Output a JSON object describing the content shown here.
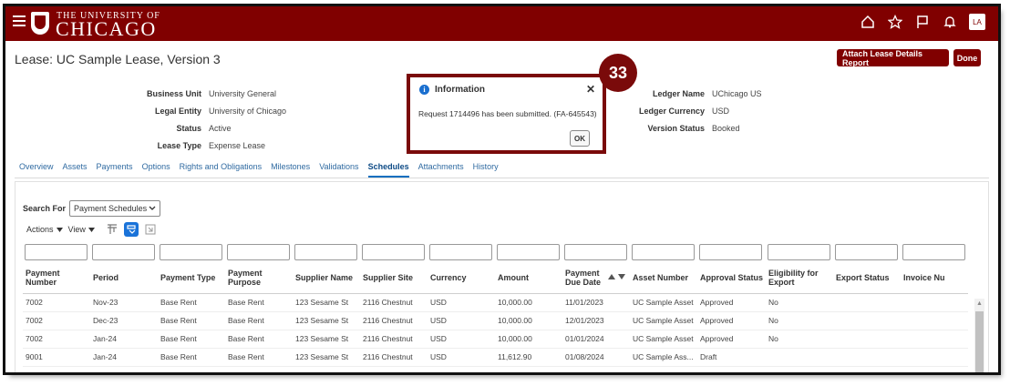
{
  "header": {
    "brand_small": "THE UNIVERSITY OF",
    "brand_big": "CHICAGO",
    "avatar": "LA"
  },
  "page": {
    "title": "Lease: UC Sample Lease, Version 3",
    "attach_button": "Attach Lease Details Report",
    "done_button": "Done"
  },
  "fields_left": [
    {
      "label": "Business Unit",
      "value": "University General"
    },
    {
      "label": "Legal Entity",
      "value": "University of Chicago"
    },
    {
      "label": "Status",
      "value": "Active"
    },
    {
      "label": "Lease Type",
      "value": "Expense Lease"
    }
  ],
  "fields_right": [
    {
      "label": "Ledger Name",
      "value": "UChicago US"
    },
    {
      "label": "Ledger Currency",
      "value": "USD"
    },
    {
      "label": "Version Status",
      "value": "Booked"
    }
  ],
  "tabs": [
    "Overview",
    "Assets",
    "Payments",
    "Options",
    "Rights and Obligations",
    "Milestones",
    "Validations",
    "Schedules",
    "Attachments",
    "History"
  ],
  "active_tab": "Schedules",
  "search": {
    "label": "Search For",
    "selected": "Payment Schedules"
  },
  "toolbar": {
    "actions": "Actions",
    "view": "View"
  },
  "table": {
    "columns": [
      "Payment Number",
      "Period",
      "Payment Type",
      "Payment Purpose",
      "Supplier Name",
      "Supplier Site",
      "Currency",
      "Amount",
      "Payment Due Date",
      "Asset Number",
      "Approval Status",
      "Eligibility for Export",
      "Export Status",
      "Invoice Nu"
    ],
    "rows": [
      [
        "7002",
        "Nov-23",
        "Base Rent",
        "Base Rent",
        "123 Sesame St",
        "2116 Chestnut",
        "USD",
        "10,000.00",
        "11/01/2023",
        "UC Sample Asset",
        "Approved",
        "No",
        "",
        ""
      ],
      [
        "7002",
        "Dec-23",
        "Base Rent",
        "Base Rent",
        "123 Sesame St",
        "2116 Chestnut",
        "USD",
        "10,000.00",
        "12/01/2023",
        "UC Sample Asset",
        "Approved",
        "No",
        "",
        ""
      ],
      [
        "7002",
        "Jan-24",
        "Base Rent",
        "Base Rent",
        "123 Sesame St",
        "2116 Chestnut",
        "USD",
        "10,000.00",
        "01/01/2024",
        "UC Sample Asset",
        "Approved",
        "No",
        "",
        ""
      ],
      [
        "9001",
        "Jan-24",
        "Base Rent",
        "Base Rent",
        "123 Sesame St",
        "2116 Chestnut",
        "USD",
        "11,612.90",
        "01/08/2024",
        "UC Sample Ass...",
        "Draft",
        "",
        "",
        ""
      ]
    ]
  },
  "dialog": {
    "title": "Information",
    "message": "Request 1714496 has been submitted. (FA-645543)",
    "ok": "OK"
  },
  "step_badge": "33"
}
